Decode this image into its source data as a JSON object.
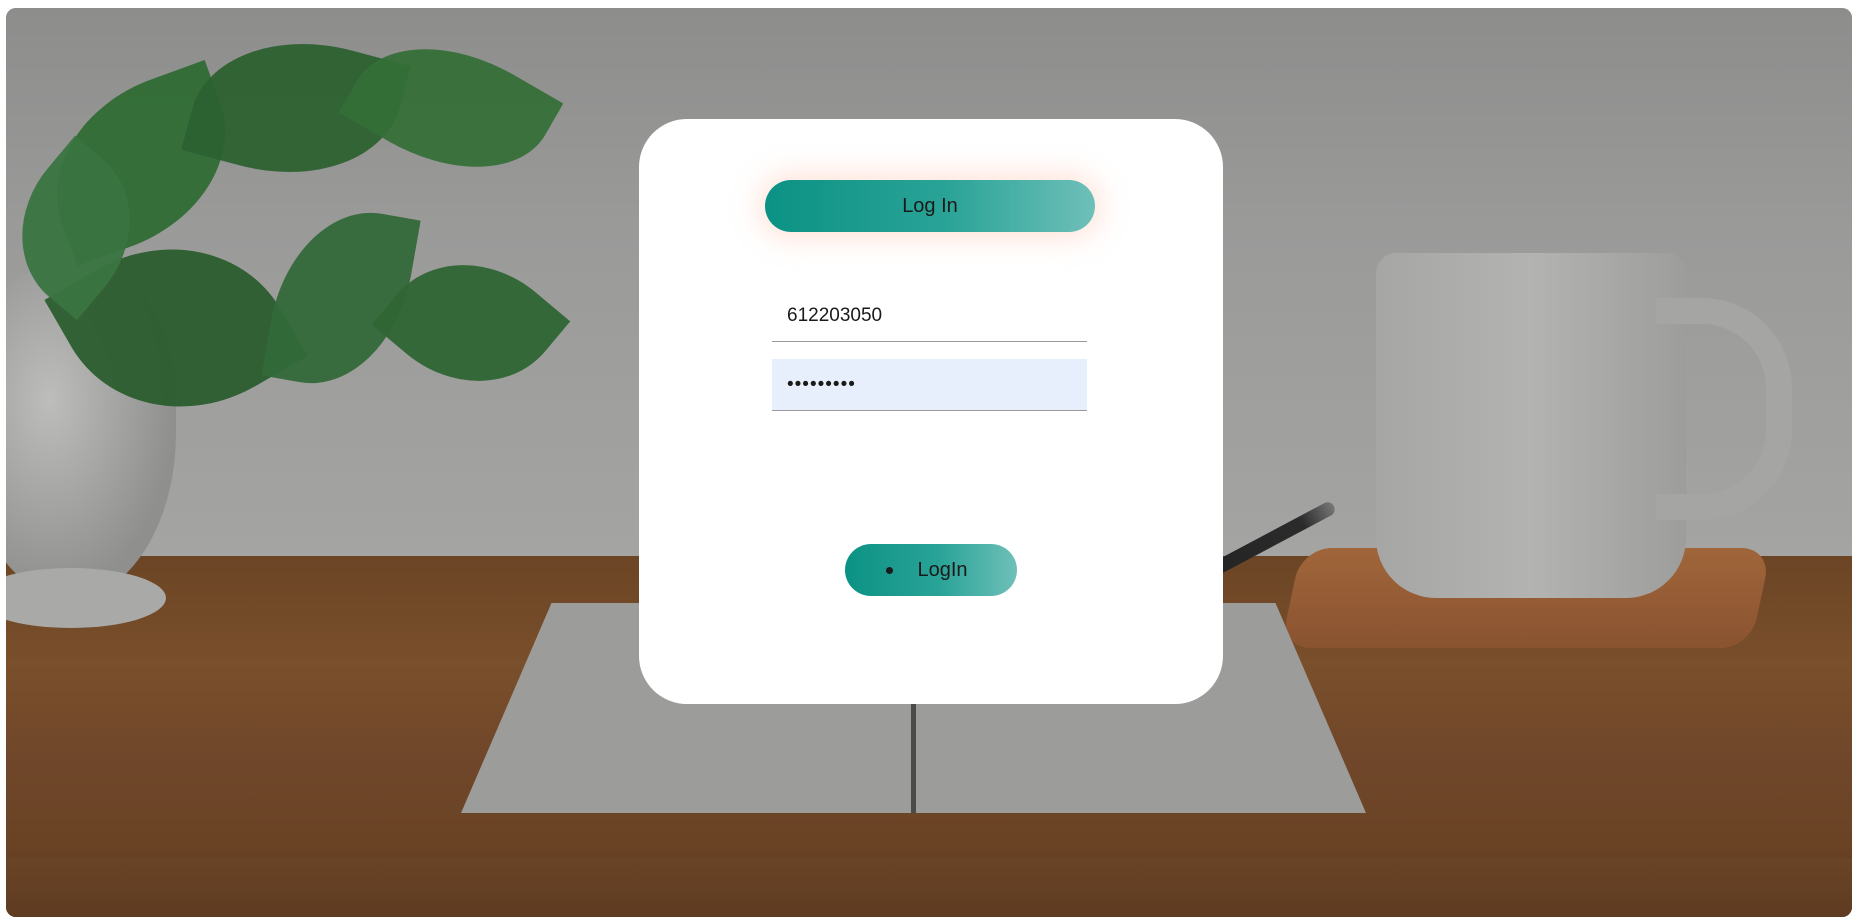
{
  "login_card": {
    "title": "Log In",
    "username_value": "612203050",
    "password_value": "•••••••••",
    "submit_label": "LogIn"
  },
  "colors": {
    "accent": "#0b9284",
    "accent_light": "#6ec0b9",
    "password_field_bg": "#e8effc"
  }
}
